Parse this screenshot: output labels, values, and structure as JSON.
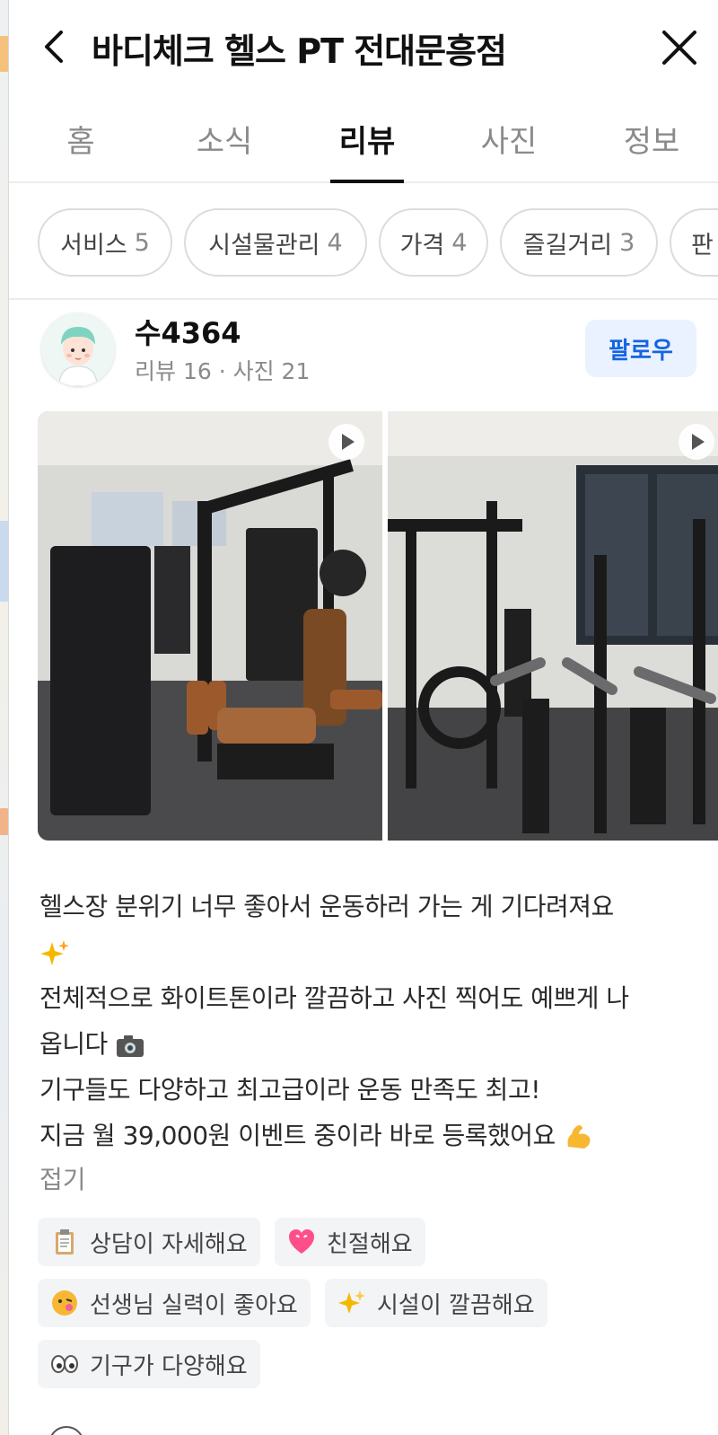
{
  "header": {
    "title": "바디체크 헬스 PT 전대문흥점",
    "back_icon": "chevron-left-icon",
    "close_icon": "close-icon"
  },
  "tabs": [
    {
      "label": "홈",
      "active": false
    },
    {
      "label": "소식",
      "active": false
    },
    {
      "label": "리뷰",
      "active": true
    },
    {
      "label": "사진",
      "active": false
    },
    {
      "label": "정보",
      "active": false
    }
  ],
  "filter_chips": [
    {
      "label": "서비스",
      "count": "5"
    },
    {
      "label": "시설물관리",
      "count": "4"
    },
    {
      "label": "가격",
      "count": "4"
    },
    {
      "label": "즐길거리",
      "count": "3"
    },
    {
      "label": "판",
      "count": ""
    }
  ],
  "review": {
    "author": "수4364",
    "meta": "리뷰 16 · 사진 21",
    "follow_label": "팔로우",
    "lines": [
      "헬스장 분위기 너무 좋아서 운동하러 가는 게 기다려져요",
      "전체적으로 화이트톤이라 깔끔하고 사진 찍어도 예쁘게 나",
      "옵니다",
      "기구들도 다양하고 최고급이라 운동 만족도 최고!",
      "지금 월 39,000원 이벤트 중이라 바로 등록했어요"
    ],
    "fold_label": "접기",
    "tags": [
      {
        "label": "상담이 자세해요",
        "icon": "clipboard-icon"
      },
      {
        "label": "친절해요",
        "icon": "heart-icon"
      },
      {
        "label": "선생님 실력이 좋아요",
        "icon": "face-icon"
      },
      {
        "label": "시설이 깔끔해요",
        "icon": "sparkles-icon"
      },
      {
        "label": "기구가 다양해요",
        "icon": "eyes-icon"
      }
    ]
  },
  "colors": {
    "accent": "#1565e0",
    "follow_bg": "#eaf2ff",
    "tag_bg": "#f3f4f6"
  }
}
